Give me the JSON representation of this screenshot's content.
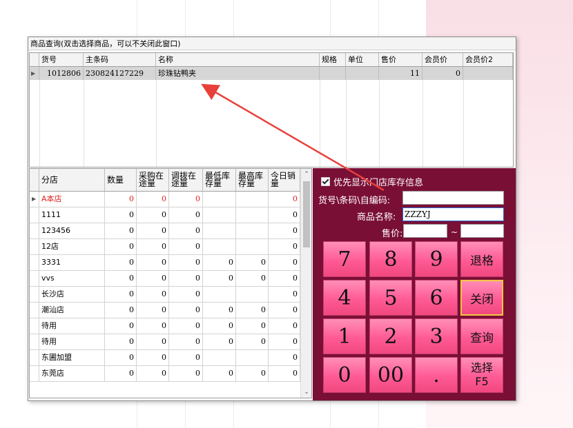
{
  "window": {
    "title": "商品查询(双击选择商品，可以不关闭此窗口)"
  },
  "product_grid": {
    "columns": [
      "货号",
      "主条码",
      "名称",
      "规格",
      "单位",
      "售价",
      "会员价",
      "会员价2"
    ],
    "rows": [
      {
        "sku": "1012806",
        "barcode": "230824127229",
        "name": "珍珠钻鸭夹",
        "spec": "",
        "unit": "",
        "price": "11",
        "member_price": "0",
        "member_price2": ""
      }
    ]
  },
  "stock_grid": {
    "columns": [
      "分店",
      "数量",
      "采购在途量",
      "调拨在途量",
      "最低库存量",
      "最高库存量",
      "今日销量"
    ],
    "rows": [
      {
        "store": "A本店",
        "qty": "0",
        "purchase_transit": "0",
        "transfer_transit": "0",
        "min_stock": "",
        "max_stock": "",
        "today_sales": "0",
        "highlight": true
      },
      {
        "store": "1111",
        "qty": "0",
        "purchase_transit": "0",
        "transfer_transit": "0",
        "min_stock": "",
        "max_stock": "",
        "today_sales": "0"
      },
      {
        "store": "123456",
        "qty": "0",
        "purchase_transit": "0",
        "transfer_transit": "0",
        "min_stock": "",
        "max_stock": "",
        "today_sales": "0"
      },
      {
        "store": "12店",
        "qty": "0",
        "purchase_transit": "0",
        "transfer_transit": "0",
        "min_stock": "",
        "max_stock": "",
        "today_sales": "0"
      },
      {
        "store": "3331",
        "qty": "0",
        "purchase_transit": "0",
        "transfer_transit": "0",
        "min_stock": "0",
        "max_stock": "0",
        "today_sales": "0"
      },
      {
        "store": "vvs",
        "qty": "0",
        "purchase_transit": "0",
        "transfer_transit": "0",
        "min_stock": "0",
        "max_stock": "0",
        "today_sales": "0"
      },
      {
        "store": "长沙店",
        "qty": "0",
        "purchase_transit": "0",
        "transfer_transit": "0",
        "min_stock": "",
        "max_stock": "",
        "today_sales": "0"
      },
      {
        "store": "潮汕店",
        "qty": "0",
        "purchase_transit": "0",
        "transfer_transit": "0",
        "min_stock": "0",
        "max_stock": "0",
        "today_sales": "0"
      },
      {
        "store": "待用",
        "qty": "0",
        "purchase_transit": "0",
        "transfer_transit": "0",
        "min_stock": "0",
        "max_stock": "0",
        "today_sales": "0"
      },
      {
        "store": "待用",
        "qty": "0",
        "purchase_transit": "0",
        "transfer_transit": "0",
        "min_stock": "0",
        "max_stock": "0",
        "today_sales": "0"
      },
      {
        "store": "东圃加盟",
        "qty": "0",
        "purchase_transit": "0",
        "transfer_transit": "0",
        "min_stock": "",
        "max_stock": "",
        "today_sales": "0"
      },
      {
        "store": "东莞店",
        "qty": "0",
        "purchase_transit": "0",
        "transfer_transit": "0",
        "min_stock": "0",
        "max_stock": "0",
        "today_sales": "0"
      }
    ]
  },
  "search_panel": {
    "checkbox_label": "优先显示门店库存信息",
    "code_label": "货号\\条码\\自编码:",
    "code_value": "",
    "name_label": "商品名称:",
    "name_value": "ZZZYJ",
    "price_label": "售价:",
    "price_from": "",
    "price_sep": "~",
    "price_to": ""
  },
  "keypad": {
    "keys": [
      "7",
      "8",
      "9",
      "4",
      "5",
      "6",
      "1",
      "2",
      "3",
      "0",
      "00",
      "."
    ],
    "backspace": "退格",
    "close": "关闭",
    "query": "查询",
    "select_line1": "选择",
    "select_line2": "F5"
  },
  "colors": {
    "panel_bg": "#7a0f36",
    "key_pink": "#ff5a95",
    "arrow": "#e8403a",
    "highlight_text": "#e02020"
  }
}
